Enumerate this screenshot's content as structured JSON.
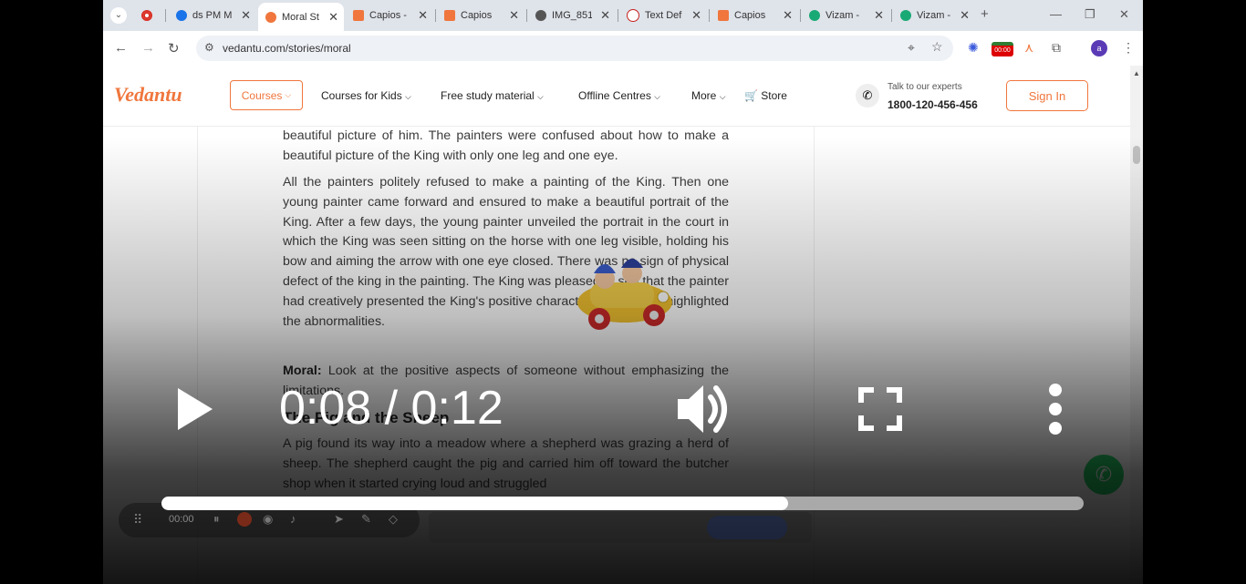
{
  "browser": {
    "tabs": [
      {
        "title": "",
        "favicon_color": "#d93025"
      },
      {
        "title": "ds PM M",
        "favicon_color": "#1a73e8"
      },
      {
        "title": "Moral St",
        "favicon_color": "#f0763d",
        "active": true
      },
      {
        "title": "Capios -",
        "favicon_color": "#f0763d"
      },
      {
        "title": "Capios",
        "favicon_color": "#f0763d"
      },
      {
        "title": "IMG_851",
        "favicon_color": "#555555"
      },
      {
        "title": "Text Def",
        "favicon_color": "#c5221f"
      },
      {
        "title": "Capios",
        "favicon_color": "#f0763d"
      },
      {
        "title": "Vizam -",
        "favicon_color": "#19a974"
      },
      {
        "title": "Vizam -",
        "favicon_color": "#19a974"
      }
    ],
    "url": "vedantu.com/stories/moral",
    "extension_badge": "00:00",
    "profile_initial": "a"
  },
  "site": {
    "logo": "Vedantu",
    "nav": {
      "courses": "Courses",
      "courses_for_kids": "Courses for Kids",
      "free_study_material": "Free study material",
      "offline_centres": "Offline Centres",
      "more": "More",
      "store": "Store"
    },
    "talk_label": "Talk to our experts",
    "phone": "1800-120-456-456",
    "sign_in": "Sign In",
    "accent_color": "#f0763d"
  },
  "article": {
    "p1": "beautiful picture of him. The painters were confused about how to make a beautiful picture of the King with only one leg and one eye.",
    "p2": "All the painters politely refused to make a painting of the King. Then one young painter came forward and ensured to make a beautiful portrait of the King. After a few days, the young painter unveiled the portrait in the court in which the King was seen sitting on the horse with one leg visible, holding his bow and aiming the arrow with one eye closed. There was no sign of physical defect of the king in the painting. The King was pleased to see that the painter had creatively presented the King's positive characteristics but not highlighted the abnormalities.",
    "moral_label": "Moral:",
    "moral_text": "Look at the positive aspects of someone without emphasizing the limitations.",
    "heading": "The Pig and the Sheep",
    "p3": "A pig found its way into a meadow where a shepherd was grazing a herd of sheep. The shepherd caught the pig and carried him off toward the butcher shop when it started crying loud and struggled"
  },
  "recorder": {
    "elapsed": "00:00"
  },
  "video": {
    "time_display": "0:08 / 0:12",
    "progress_fraction": 0.68
  }
}
